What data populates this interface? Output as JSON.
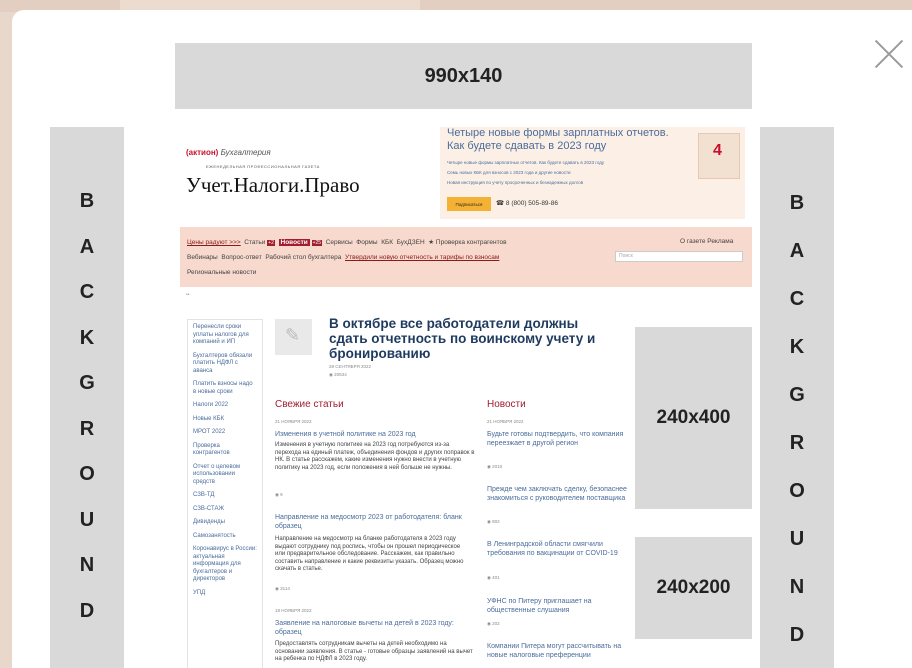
{
  "ads": {
    "top": "990x140",
    "left_letters": [
      "B",
      "A",
      "C",
      "K",
      "G",
      "R",
      "O",
      "U",
      "N",
      "D"
    ],
    "right_letters": [
      "B",
      "A",
      "C",
      "K",
      "G",
      "R",
      "O",
      "U",
      "N",
      "D"
    ],
    "mid1": "240x400",
    "mid2": "240x200"
  },
  "site": {
    "logo_brand": "(актион)",
    "logo_brand_sub": "Бухгалтерия",
    "logo_tagline": "ЕЖЕНЕДЕЛЬНАЯ ПРОФЕССИОНАЛЬНАЯ ГАЗЕТА",
    "logo_title": "Учет.Налоги.Право",
    "promo": {
      "title": "Четыре новые формы зарплатных отчетов. Как будете сдавать в 2023 году",
      "lines": [
        "Четыре новые формы зарплатных отчетов. Как будете сдавать в 2023 году",
        "Семь новых КБК для взносов с 2023 года и другие новости",
        "Новая инструкция по учету просроченных и безнадежных долгов"
      ],
      "button": "Подписаться",
      "phone": "☎ 8 (800) 505-89-86",
      "cal_number": "4"
    },
    "nav": {
      "row1": {
        "prices": "Цены радуют >>>",
        "items": [
          "Статьи",
          "Новости",
          "Сервисы",
          "Формы",
          "КБК",
          "БухДЗЕН",
          "★ Проверка контрагентов"
        ],
        "badge1": "+2",
        "badge2": "+25"
      },
      "right": "О газете   Реклама",
      "row2": {
        "items": [
          "Вебинары",
          "Вопрос-ответ",
          "Рабочий стол бухгалтера"
        ],
        "link": "Утвердили новую отчетность и тарифы по взносам"
      },
      "row3": "Региональные новости",
      "search_placeholder": "Поиск"
    },
    "sidebar": [
      "Перенесли сроки уплаты налогов для компаний и ИП",
      "Бухгалтеров обязали платить НДФЛ с аванса",
      "Платить взносы надо в новые сроки",
      "Налоги 2022",
      "Новые КБК",
      "МРОТ 2022",
      "Проверка контрагентов",
      "Отчет о целевом использовании средств",
      "СЗВ-ТД",
      "СЗВ-СТАЖ",
      "Дивиденды",
      "Самозанятость",
      "Коронавирус в России: актуальная информация для бухгалтеров и директоров",
      "УПД"
    ],
    "featured": {
      "title": "В октябре все работодатели должны сдать отчетность по воинскому учету и бронированию",
      "date": "28 СЕНТЯБРЯ 2022",
      "views": "◉ 20534"
    },
    "fresh": {
      "heading": "Свежие статьи",
      "articles": [
        {
          "date": "21 НОЯБРЯ 2022",
          "title": "Изменения в учетной политике на 2023 год",
          "text": "Изменения в учетную политике на 2023 год потребуются из-за перехода на единый платеж, объединения фондов и других поправок в НК. В статье расскажем, какие изменения нужно внести в учетную политику на 2023 год, если положения в ней больше не нужны.",
          "views": "◉ 9"
        },
        {
          "date": "",
          "title": "Направление на медосмотр 2023 от работодателя: бланк образец",
          "text": "Направление на медосмотр на бланке работодателя в 2023 году выдают сотруднику под роспись, чтобы он прошел периодическое или предварительное обследование. Расскажем, как правильно составить направление и какие реквизиты указать. Образец можно скачать в статье.",
          "views": "◉ 3114"
        },
        {
          "date": "18 НОЯБРЯ 2022",
          "title": "Заявление на налоговые вычеты на детей в 2023 году: образец",
          "text": "Предоставлять сотрудникам вычеты на детей необходимо на основании заявления. В статье - готовые образцы заявлений на вычет на ребенка по НДФЛ в 2023 году.",
          "views": ""
        }
      ]
    },
    "news": {
      "heading": "Новости",
      "items": [
        {
          "date": "21 НОЯБРЯ 2022",
          "title": "Будьте готовы подтвердить, что компания переезжает в другой регион",
          "views": "◉ 2010"
        },
        {
          "date": "",
          "title": "Прежде чем заключать сделку, безопаснее знакомиться с руководителем поставщика",
          "views": "◉ 802"
        },
        {
          "date": "",
          "title": "В Ленинградской области смягчили требования по вакцинации от COVID-19",
          "views": "◉ 401"
        },
        {
          "date": "",
          "title": "УФНС по Питеру приглашает на общественные слушания",
          "views": "◉ 202"
        },
        {
          "date": "",
          "title": "Компании Питера могут рассчитывать на новые налоговые преференции",
          "views": ""
        }
      ]
    }
  }
}
